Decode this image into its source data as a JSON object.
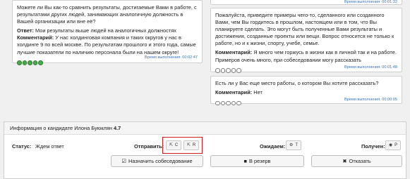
{
  "left_card": {
    "question": "Можете ли Вы как-то сравнить результаты, достигаемые Вами в работе, с результатами других людей, занимающих аналогичную должность в Вашей организации или вне её?",
    "answer_label": "Ответ:",
    "answer_text": "Мои результаты выше людей на аналогичных должностях",
    "comment_label": "Комментарий:",
    "comment_text": "У нас холдинговая компания и таких округов у нас в холдинге 9 по всей москве. По результатам прошлого и этого года, самые лучшие показатели по наличию персонала были на нашем округе!",
    "rating": 5,
    "time": "Время выполнения: 00:02:47"
  },
  "top_right_card": {
    "time": "Время выполнения: 00:01:32"
  },
  "mid_right_card": {
    "question": "Пожалуйста, приведите примеры чего-то, сделанного или созданного Вами, чем Вы гордитесь в прошлом, настоящем или в том, что Вы планируете сделать. Это могут быть полученные Вами результаты и достижения, созданные проекты или вещи. Вопрос относится не только к работе, но и к жизни, спорту, учебе, семье.",
    "comment_label": "Комментарий:",
    "comment_text": "Я много чем горжусь в жизни как в личной так и на работе. Примеров очень много, при собеседовании могу рассказать",
    "rating": 0,
    "time": "Время выполнения: 00:01:48"
  },
  "bottom_right_card": {
    "question": "Есть ли у Вас еще место работы, о котором Вы хотите рассказать?",
    "comment_label": "Комментарий:",
    "comment_text": "Нет",
    "rating": 0,
    "time": "Время выполнения: 00:00:05"
  },
  "candidate": {
    "header_prefix": "Информация о кандидате Илона Буюклян",
    "score": "4.7",
    "status_label": "Статус:",
    "status_value": "Ждем ответ",
    "send_label": "Отправить:",
    "send_c": "C",
    "send_r": "R",
    "waiting_label": "Ожидаем:",
    "waiting_value": "T",
    "received_label": "Получен:",
    "received_value": "P"
  },
  "actions": {
    "schedule": "Назначить собеседование",
    "reserve": "В резерв",
    "decline": "Отказать"
  },
  "colors": {
    "accent": "#3a73b3",
    "highlight": "#d21c1c",
    "rating_fill": "#48a84a"
  }
}
